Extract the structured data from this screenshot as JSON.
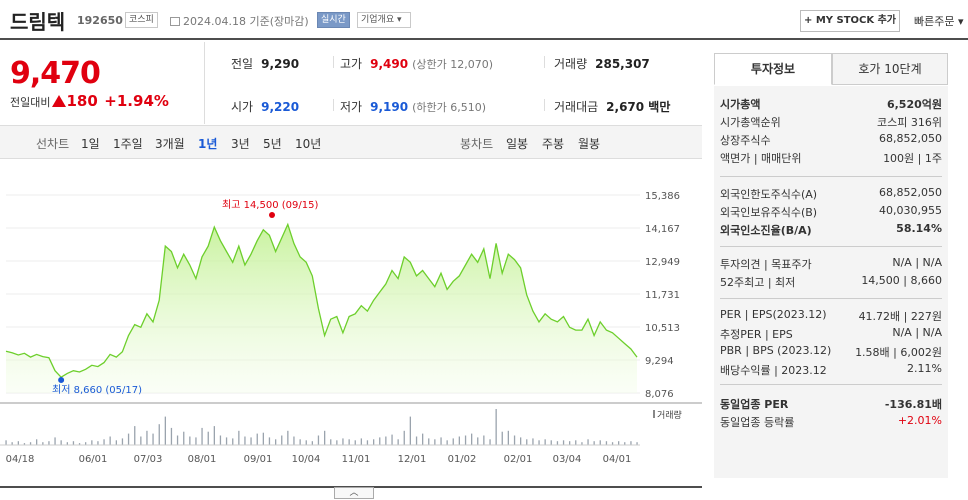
{
  "header": {
    "company": "드림텍",
    "code": "192650",
    "market": "코스피",
    "date": "2024.04.18",
    "basis": "기준(장마감)",
    "realtime": "실시간",
    "overview": "기업개요",
    "mystock": "+ MY STOCK 추가",
    "quick_order": "빠른주문"
  },
  "price": {
    "current": "9,470",
    "change_label": "전일대비",
    "change": "180",
    "change_pct": "+1.94%"
  },
  "stats": {
    "prev_label": "전일",
    "prev": "9,290",
    "high_label": "고가",
    "high": "9,490",
    "upper_limit": "(상한가 12,070)",
    "volume_label": "거래량",
    "volume": "285,307",
    "open_label": "시가",
    "open": "9,220",
    "low_label": "저가",
    "low": "9,190",
    "lower_limit": "(하한가 6,510)",
    "amount_label": "거래대금",
    "amount": "2,670 백만"
  },
  "periods": {
    "line_label": "선차트",
    "items": [
      "1일",
      "1주일",
      "3개월",
      "1년",
      "3년",
      "5년",
      "10년"
    ],
    "active": "1년",
    "candle_label": "봉차트",
    "candle_items": [
      "일봉",
      "주봉",
      "월봉"
    ]
  },
  "chart_data": {
    "type": "area",
    "y_ticks": [
      "15,386",
      "14,167",
      "12,949",
      "11,731",
      "10,513",
      "9,294",
      "8,076"
    ],
    "ylim": [
      8076,
      15386
    ],
    "x_ticks": [
      "04/18",
      "06/01",
      "07/03",
      "08/01",
      "09/01",
      "10/04",
      "11/01",
      "12/01",
      "01/02",
      "02/01",
      "03/04",
      "04/01"
    ],
    "high_annotation": "최고 14,500 (09/15)",
    "low_annotation": "최저 8,660 (05/17)",
    "volume_label": "거래량",
    "series": [
      {
        "values": [
          9620,
          9560,
          9480,
          9540,
          9400,
          9500,
          9420,
          9380,
          8900,
          8660,
          8800,
          8900,
          8850,
          8950,
          9100,
          9050,
          9200,
          9500,
          9400,
          9600,
          10200,
          10600,
          10500,
          11000,
          10700,
          11500,
          13500,
          13300,
          12700,
          13200,
          12800,
          12300,
          13100,
          13500,
          14200,
          13700,
          13300,
          12900,
          13500,
          12800,
          13200,
          13700,
          14100,
          13900,
          13300,
          13800,
          14300,
          13600,
          13100,
          12900,
          12400,
          11200,
          10200,
          10800,
          10900,
          10300,
          10900,
          11000,
          11300,
          11100,
          11500,
          11800,
          12100,
          12600,
          12300,
          13100,
          12900,
          12400,
          12600,
          12300,
          12000,
          12500,
          11900,
          12200,
          12400,
          12800,
          13200,
          12900,
          13400,
          12300,
          13600,
          12500,
          13200,
          13000,
          12700,
          11700,
          11100,
          10700,
          11000,
          10800,
          10700,
          10900,
          10500,
          10400,
          10400,
          10800,
          10200,
          10700,
          10400,
          10300,
          10100,
          9900,
          9700,
          9400
        ]
      }
    ],
    "volume": [
      5,
      3,
      4,
      2,
      3,
      6,
      3,
      4,
      8,
      5,
      3,
      4,
      2,
      3,
      5,
      4,
      6,
      9,
      5,
      7,
      12,
      20,
      9,
      15,
      12,
      22,
      30,
      18,
      10,
      14,
      9,
      8,
      18,
      14,
      20,
      10,
      8,
      7,
      15,
      9,
      8,
      12,
      13,
      8,
      6,
      10,
      15,
      9,
      6,
      5,
      4,
      10,
      15,
      6,
      5,
      7,
      6,
      5,
      7,
      5,
      6,
      8,
      9,
      11,
      6,
      15,
      30,
      9,
      12,
      7,
      6,
      8,
      5,
      7,
      9,
      10,
      12,
      8,
      10,
      6,
      38,
      14,
      15,
      10,
      8,
      6,
      7,
      5,
      6,
      5,
      4,
      5,
      4,
      5,
      3,
      6,
      4,
      5,
      4,
      3,
      4,
      3,
      4,
      3
    ]
  },
  "side": {
    "tabs": [
      "투자정보",
      "호가 10단계"
    ],
    "rows": [
      {
        "k": "시가총액",
        "v": "6,520억원",
        "bold": true
      },
      {
        "k": "시가총액순위",
        "v": "코스피 316위"
      },
      {
        "k": "상장주식수",
        "v": "68,852,050"
      },
      {
        "k": "액면가 | 매매단위",
        "v": "100원 | 1주"
      },
      {
        "k": "외국인한도주식수(A)",
        "v": "68,852,050"
      },
      {
        "k": "외국인보유주식수(B)",
        "v": "40,030,955"
      },
      {
        "k": "외국인소진율(B/A)",
        "v": "58.14%",
        "bold": true
      },
      {
        "k": "투자의견 | 목표주가",
        "v": "N/A | N/A"
      },
      {
        "k": "52주최고 | 최저",
        "v": "14,500 | 8,660"
      },
      {
        "k": "PER | EPS(2023.12)",
        "v": "41.72배 | 227원"
      },
      {
        "k": "추정PER | EPS",
        "v": "N/A | N/A"
      },
      {
        "k": "PBR | BPS (2023.12)",
        "v": "1.58배 | 6,002원"
      },
      {
        "k": "배당수익률 | 2023.12",
        "v": "2.11%"
      },
      {
        "k": "동일업종 PER",
        "v": "-136.81배",
        "bold": true
      },
      {
        "k": "동일업종 등락률",
        "v": "+2.01%",
        "red": true
      }
    ]
  }
}
